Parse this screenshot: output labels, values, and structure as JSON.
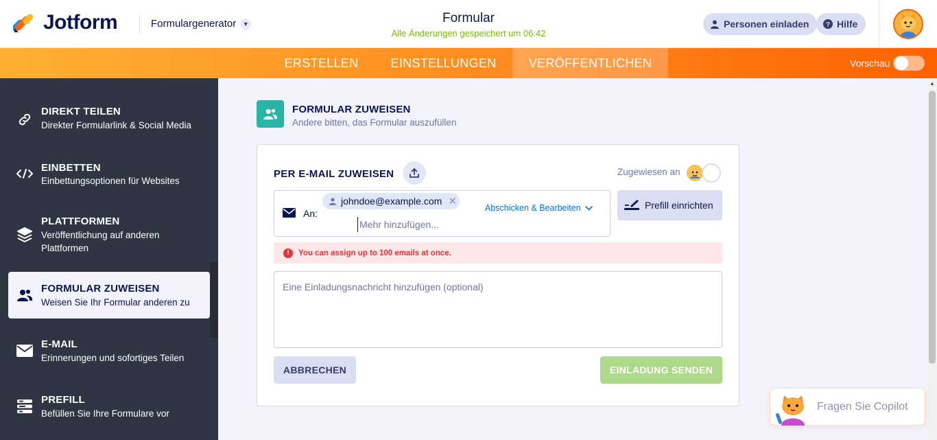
{
  "header": {
    "logo_text": "Jotform",
    "product_label": "Formulargenerator",
    "form_title": "Formular",
    "save_status": "Alle Änderungen gespeichert um 06:42",
    "invite_label": "Personen einladen",
    "help_label": "Hilfe"
  },
  "nav": {
    "tabs": [
      {
        "label": "ERSTELLEN"
      },
      {
        "label": "EINSTELLUNGEN"
      },
      {
        "label": "VERÖFFENTLICHEN"
      }
    ],
    "active_tab": "VERÖFFENTLICHEN",
    "preview_label": "Vorschau",
    "preview_enabled": false
  },
  "sidebar": {
    "items": [
      {
        "title": "DIREKT TEILEN",
        "subtitle": "Direkter Formularlink & Social Media",
        "icon": "link-icon"
      },
      {
        "title": "EINBETTEN",
        "subtitle": "Einbettungsoptionen für Websites",
        "icon": "code-icon"
      },
      {
        "title": "PLATTFORMEN",
        "subtitle": "Veröffentlichung auf anderen Plattformen",
        "icon": "layers-icon"
      },
      {
        "title": "FORMULAR ZUWEISEN",
        "subtitle": "Weisen Sie Ihr Formular anderen zu",
        "icon": "users-icon",
        "active": true
      },
      {
        "title": "E-MAIL",
        "subtitle": "Erinnerungen und sofortiges Teilen",
        "icon": "mail-icon"
      },
      {
        "title": "PREFILL",
        "subtitle": "Befüllen Sie Ihre Formulare vor",
        "icon": "prefill-icon"
      }
    ]
  },
  "section": {
    "title": "FORMULAR ZUWEISEN",
    "subtitle": "Andere bitten, das Formular auszufüllen"
  },
  "card": {
    "title": "PER E-MAIL ZUWEISEN",
    "assigned_label": "Zugewiesen an",
    "to_label": "An:",
    "recipient_chip": "johndoe@example.com",
    "add_more_placeholder": "Mehr hinzufügen...",
    "send_edit_label": "Abschicken & Bearbeiten",
    "prefill_label": "Prefill einrichten",
    "alert_text": "You can assign up to 100 emails at once.",
    "message_placeholder": "Eine Einladungsnachricht hinzufügen (optional)",
    "cancel_label": "ABBRECHEN",
    "send_label": "EINLADUNG SENDEN"
  },
  "copilot": {
    "label": "Fragen Sie Copilot"
  },
  "colors": {
    "accent_orange": "#ff6100",
    "teal": "#28b5a8",
    "sidebar_bg": "#2f3542",
    "success_green": "#78bb07",
    "error_red": "#e53539",
    "link_blue": "#0075e3"
  }
}
